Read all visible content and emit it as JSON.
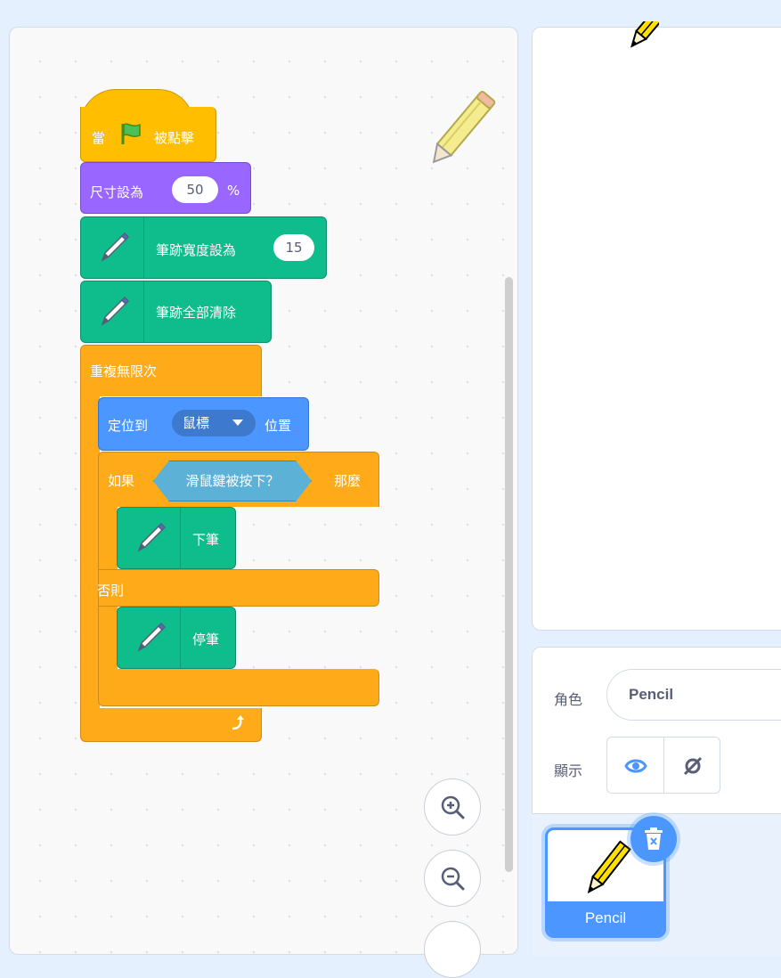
{
  "colors": {
    "events": "#ffbf00",
    "looks": "#9966ff",
    "pen": "#0fbd8c",
    "control": "#ffab19",
    "motion": "#4c97ff",
    "sensing": "#5cb1d6",
    "accent": "#4c97ff"
  },
  "blocks": {
    "when_flag": {
      "pre": "當",
      "post": "被點擊",
      "flag_icon": "green-flag-icon"
    },
    "set_size": {
      "label": "尺寸設為",
      "value": "50",
      "suffix": "%"
    },
    "pen_size": {
      "label": "筆跡寬度設為",
      "value": "15",
      "icon": "pen-icon"
    },
    "pen_clear": {
      "label": "筆跡全部清除",
      "icon": "pen-icon"
    },
    "forever": {
      "label": "重複無限次",
      "loop_icon": "loop-arrow-icon"
    },
    "goto": {
      "label": "定位到",
      "target": "鼠標",
      "suffix": "位置"
    },
    "if_else": {
      "if_label": "如果",
      "condition": "滑鼠鍵被按下？",
      "then_label": "那麼",
      "else_label": "否則"
    },
    "pen_down": {
      "label": "下筆",
      "icon": "pen-icon"
    },
    "pen_up": {
      "label": "停筆",
      "icon": "pen-icon"
    }
  },
  "zoom_controls": [
    "zoom-in-icon",
    "zoom-out-icon"
  ],
  "sprite_info": {
    "sprite_label": "角色",
    "sprite_name": "Pencil",
    "show_label": "顯示",
    "show_icon": "eye-icon",
    "hide_icon": "eye-slash-icon"
  },
  "sprite_list": [
    {
      "name": "Pencil",
      "selected": true,
      "delete_icon": "trash-icon"
    }
  ]
}
